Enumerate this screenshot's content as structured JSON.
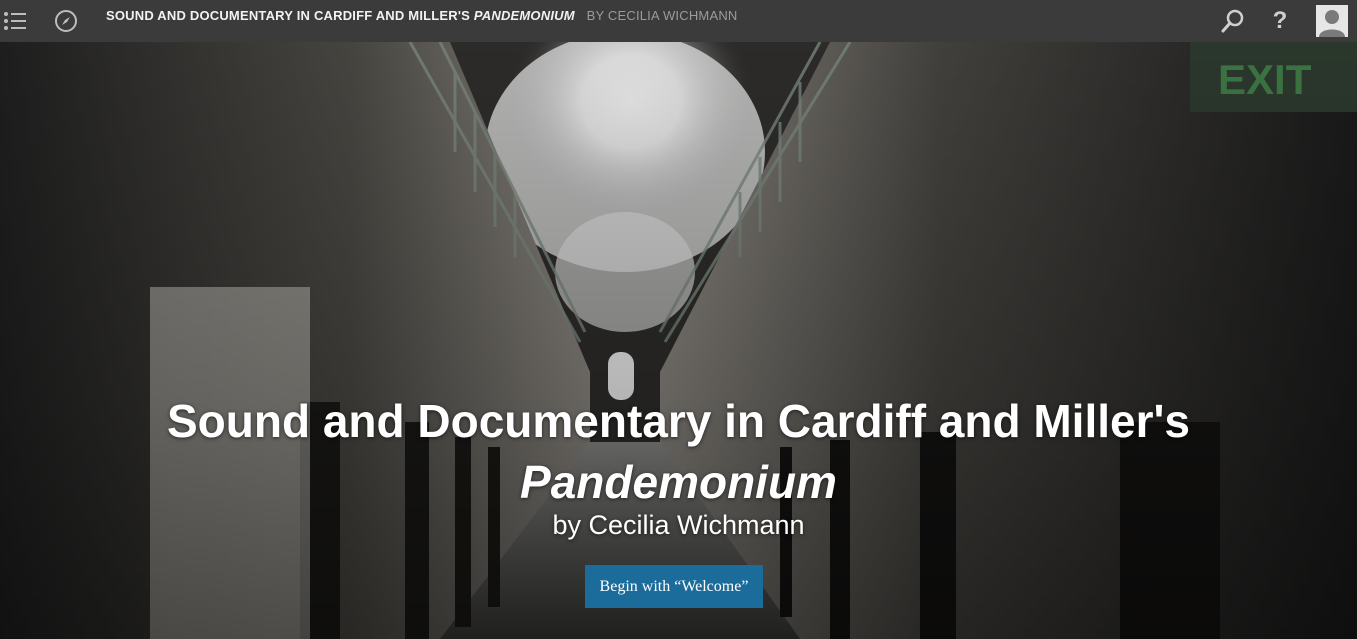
{
  "topbar": {
    "book_title_main": "SOUND AND DOCUMENTARY IN CARDIFF AND MILLER'S",
    "book_title_italic": "PANDEMONIUM",
    "book_author": "BY CECILIA WICHMANN",
    "help_glyph": "?"
  },
  "hero": {
    "title_line1": "Sound and Documentary in Cardiff and Miller's",
    "title_line2": "Pandemonium",
    "byline": "by Cecilia Wichmann",
    "begin_button": "Begin with “Welcome”"
  },
  "icons": [
    "menu-icon",
    "compass-icon",
    "search-icon",
    "help-icon",
    "user-icon"
  ],
  "colors": {
    "topbar": "#3b3b3b",
    "button": "#1b6b9b",
    "hero_text": "#ffffff"
  }
}
